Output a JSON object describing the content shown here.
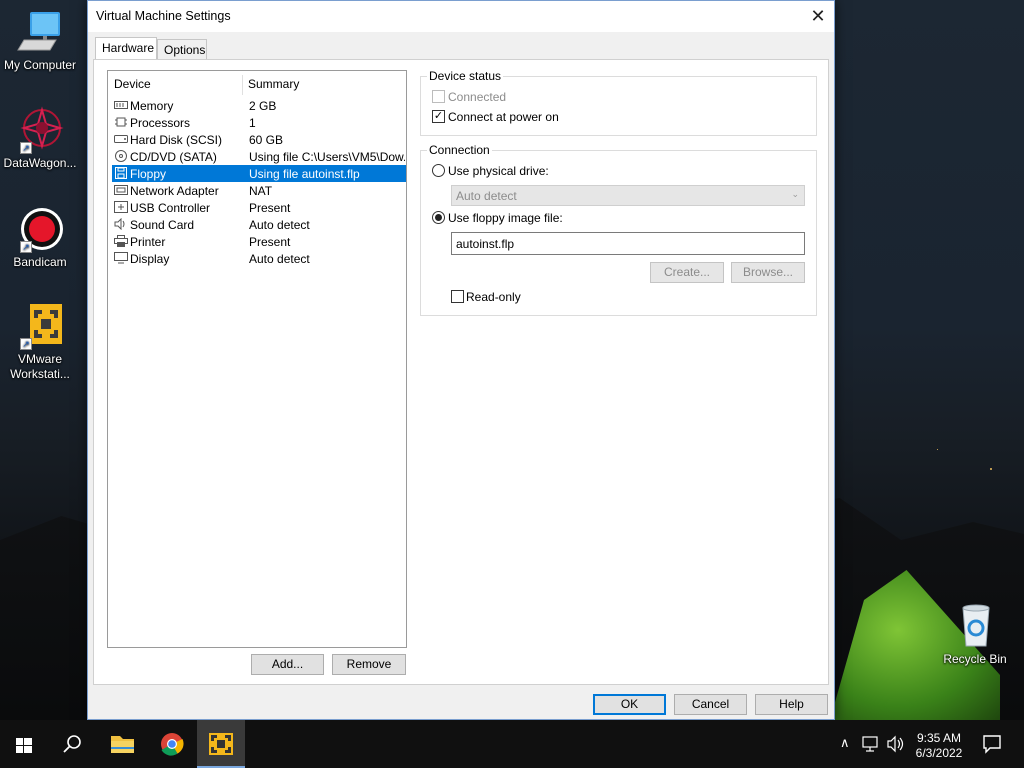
{
  "desktop": {
    "icons": [
      {
        "label": "My Computer"
      },
      {
        "label": "DataWagon..."
      },
      {
        "label": "Bandicam"
      },
      {
        "label": "VMware Workstati..."
      },
      {
        "label": "Recycle Bin"
      }
    ]
  },
  "dialog": {
    "title": "Virtual Machine Settings",
    "close_glyph": "✕",
    "tabs": [
      {
        "label": "Hardware",
        "active": true
      },
      {
        "label": "Options",
        "active": false
      }
    ],
    "device_list": {
      "col_device": "Device",
      "col_summary": "Summary",
      "rows": [
        {
          "icon": "memory-icon",
          "name": "Memory",
          "summary": "2 GB",
          "selected": false
        },
        {
          "icon": "processor-icon",
          "name": "Processors",
          "summary": "1",
          "selected": false
        },
        {
          "icon": "hard-disk-icon",
          "name": "Hard Disk (SCSI)",
          "summary": "60 GB",
          "selected": false
        },
        {
          "icon": "cd-dvd-icon",
          "name": "CD/DVD (SATA)",
          "summary": "Using file C:\\Users\\VM5\\Dow...",
          "selected": false
        },
        {
          "icon": "floppy-icon",
          "name": "Floppy",
          "summary": "Using file autoinst.flp",
          "selected": true
        },
        {
          "icon": "network-adapter-icon",
          "name": "Network Adapter",
          "summary": "NAT",
          "selected": false
        },
        {
          "icon": "usb-controller-icon",
          "name": "USB Controller",
          "summary": "Present",
          "selected": false
        },
        {
          "icon": "sound-card-icon",
          "name": "Sound Card",
          "summary": "Auto detect",
          "selected": false
        },
        {
          "icon": "printer-icon",
          "name": "Printer",
          "summary": "Present",
          "selected": false
        },
        {
          "icon": "display-icon",
          "name": "Display",
          "summary": "Auto detect",
          "selected": false
        }
      ]
    },
    "add_button": "Add...",
    "remove_button": "Remove",
    "device_status": {
      "legend": "Device status",
      "connected_label": "Connected",
      "connected_checked": false,
      "connect_power_label": "Connect at power on",
      "connect_power_checked": true
    },
    "connection": {
      "legend": "Connection",
      "physical_label": "Use physical drive:",
      "physical_selected": false,
      "physical_value": "Auto detect",
      "image_label": "Use floppy image file:",
      "image_selected": true,
      "image_value": "autoinst.flp",
      "create_button": "Create...",
      "browse_button": "Browse...",
      "readonly_label": "Read-only",
      "readonly_checked": false
    },
    "ok_button": "OK",
    "cancel_button": "Cancel",
    "help_button": "Help"
  },
  "taskbar": {
    "time": "9:35 AM",
    "date": "6/3/2022"
  },
  "colors": {
    "selection": "#0078d7",
    "dialog_bg": "#f0f0f0",
    "taskbar_bg": "#101010"
  }
}
